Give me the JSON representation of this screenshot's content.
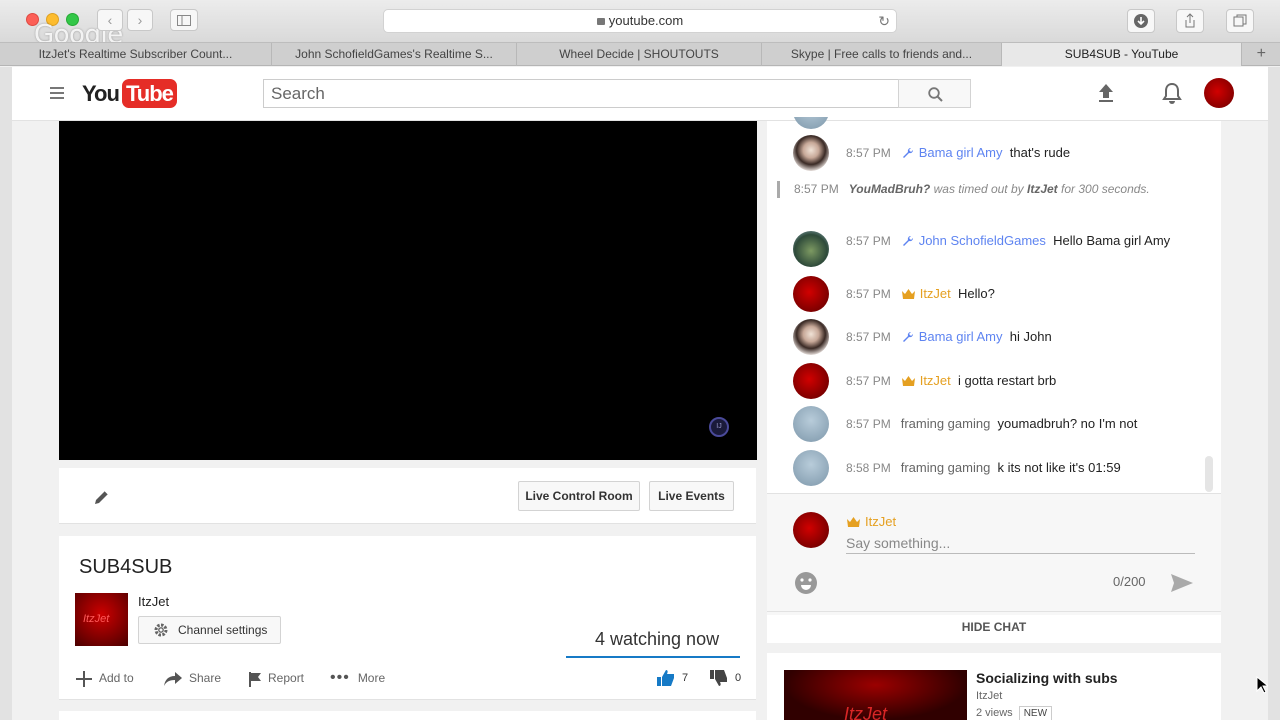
{
  "browser": {
    "url": "youtube.com",
    "watermark": "Google",
    "tabs": [
      {
        "label": "ItzJet's Realtime Subscriber Count...",
        "active": false
      },
      {
        "label": "John SchofieldGames's Realtime S...",
        "active": false
      },
      {
        "label": "Wheel Decide | SHOUTOUTS",
        "active": false
      },
      {
        "label": "Skype | Free calls to friends and...",
        "active": false
      },
      {
        "label": "SUB4SUB - YouTube",
        "active": true
      }
    ]
  },
  "header": {
    "logo_you": "You",
    "logo_tube": "Tube",
    "search_placeholder": "Search"
  },
  "toolbar": {
    "live_control_room": "Live Control Room",
    "live_events": "Live Events"
  },
  "video": {
    "title": "SUB4SUB",
    "channel": "ItzJet",
    "channel_thumb_text": "ItzJet",
    "channel_settings": "Channel settings",
    "watching": "4 watching now",
    "watching_fraction": 1.0,
    "actions": {
      "add_to": "Add to",
      "share": "Share",
      "report": "Report",
      "more": "More"
    },
    "likes": "7",
    "dislikes": "0"
  },
  "chat": {
    "messages": [
      {
        "time": "8:57 PM",
        "author": "Bama girl Amy",
        "role": "moderator",
        "text": "that's rude"
      },
      {
        "time": "8:57 PM",
        "author": "John SchofieldGames",
        "role": "moderator",
        "text": "Hello Bama girl Amy"
      },
      {
        "time": "8:57 PM",
        "author": "ItzJet",
        "role": "owner",
        "text": "Hello?"
      },
      {
        "time": "8:57 PM",
        "author": "Bama girl Amy",
        "role": "moderator",
        "text": "hi John"
      },
      {
        "time": "8:57 PM",
        "author": "ItzJet",
        "role": "owner",
        "text": "i gotta restart brb"
      },
      {
        "time": "8:57 PM",
        "author": "framing gaming",
        "role": "viewer",
        "text": "youmadbruh? no I'm not"
      },
      {
        "time": "8:58 PM",
        "author": "framing gaming",
        "role": "viewer",
        "text": "k its not like it's 01:59"
      }
    ],
    "system": {
      "time": "8:57 PM",
      "user": "YouMadBruh?",
      "mid": "was timed out by",
      "by": "ItzJet",
      "tail": "for 300 seconds."
    },
    "composer": {
      "name": "ItzJet",
      "placeholder": "Say something...",
      "counter": "0/200"
    },
    "hide_chat": "HIDE CHAT"
  },
  "related": {
    "title": "Socializing with subs",
    "channel": "ItzJet",
    "views": "2 views",
    "badge": "NEW",
    "thumb_text": "ItzJet"
  },
  "colors": {
    "brand_red": "#e52d27",
    "moderator_blue": "#5e84f1",
    "owner_gold": "#e5a021"
  }
}
